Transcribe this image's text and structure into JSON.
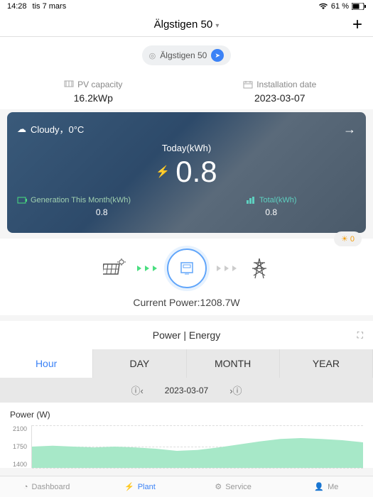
{
  "status": {
    "time": "14:28",
    "date": "tis 7 mars",
    "wifi": "wifi-icon",
    "battery_pct": "61 %",
    "battery": "battery-icon"
  },
  "header": {
    "title": "Älgstigen 50",
    "plus": "+"
  },
  "location_chip": "Älgstigen 50",
  "info": {
    "pv_label": "PV capacity",
    "pv_value": "16.2kWp",
    "install_label": "Installation date",
    "install_value": "2023-03-07"
  },
  "card": {
    "weather": "Cloudy，0°C",
    "today_label": "Today(kWh)",
    "today_value": "0.8",
    "gen_month_label": "Generation This Month(kWh)",
    "gen_month_value": "0.8",
    "total_label": "Total(kWh)",
    "total_value": "0.8"
  },
  "badge_value": "0",
  "current_power_label": "Current Power:",
  "current_power_value": "1208.7W",
  "chart_section_title": "Power | Energy",
  "tabs": {
    "hour": "Hour",
    "day": "DAY",
    "month": "MONTH",
    "year": "YEAR"
  },
  "date_nav": "2023-03-07",
  "chart_ylabel": "Power (W)",
  "chart_data": {
    "type": "area",
    "ylabel": "Power (W)",
    "y_ticks": [
      1400,
      1750,
      2100
    ],
    "ylim": [
      1200,
      2200
    ],
    "values": [
      1700,
      1720,
      1700,
      1680,
      1700,
      1680,
      1650,
      1600,
      1620,
      1680,
      1750,
      1820,
      1880,
      1900,
      1880,
      1850,
      1800
    ],
    "color": "#a7e8c8"
  },
  "nav": {
    "dashboard": "Dashboard",
    "plant": "Plant",
    "service": "Service",
    "me": "Me"
  }
}
